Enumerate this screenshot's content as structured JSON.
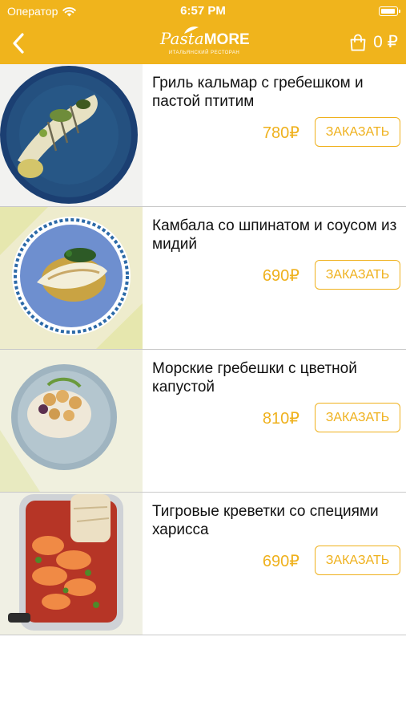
{
  "status_bar": {
    "carrier": "Оператор",
    "time": "6:57 PM"
  },
  "header": {
    "logo_text": "Pasta",
    "logo_text_bold": "MORE",
    "logo_tagline": "ИТАЛЬЯНСКИЙ РЕСТОРАН"
  },
  "cart": {
    "total": "0 ₽"
  },
  "colors": {
    "accent": "#f0b41c",
    "price": "#efb11d",
    "divider": "#c9c9c9"
  },
  "menu": {
    "items": [
      {
        "name": "Гриль кальмар с гребешком и пастой птитим",
        "price": "780₽",
        "button": "ЗАКАЗАТЬ"
      },
      {
        "name": "Камбала со шпинатом и соусом из мидий",
        "price": "690₽",
        "button": "ЗАКАЗАТЬ"
      },
      {
        "name": "Морские гребешки с цветной капустой",
        "price": "810₽",
        "button": "ЗАКАЗАТЬ"
      },
      {
        "name": "Тигровые креветки со специями харисса",
        "price": "690₽",
        "button": "ЗАКАЗАТЬ"
      }
    ]
  }
}
